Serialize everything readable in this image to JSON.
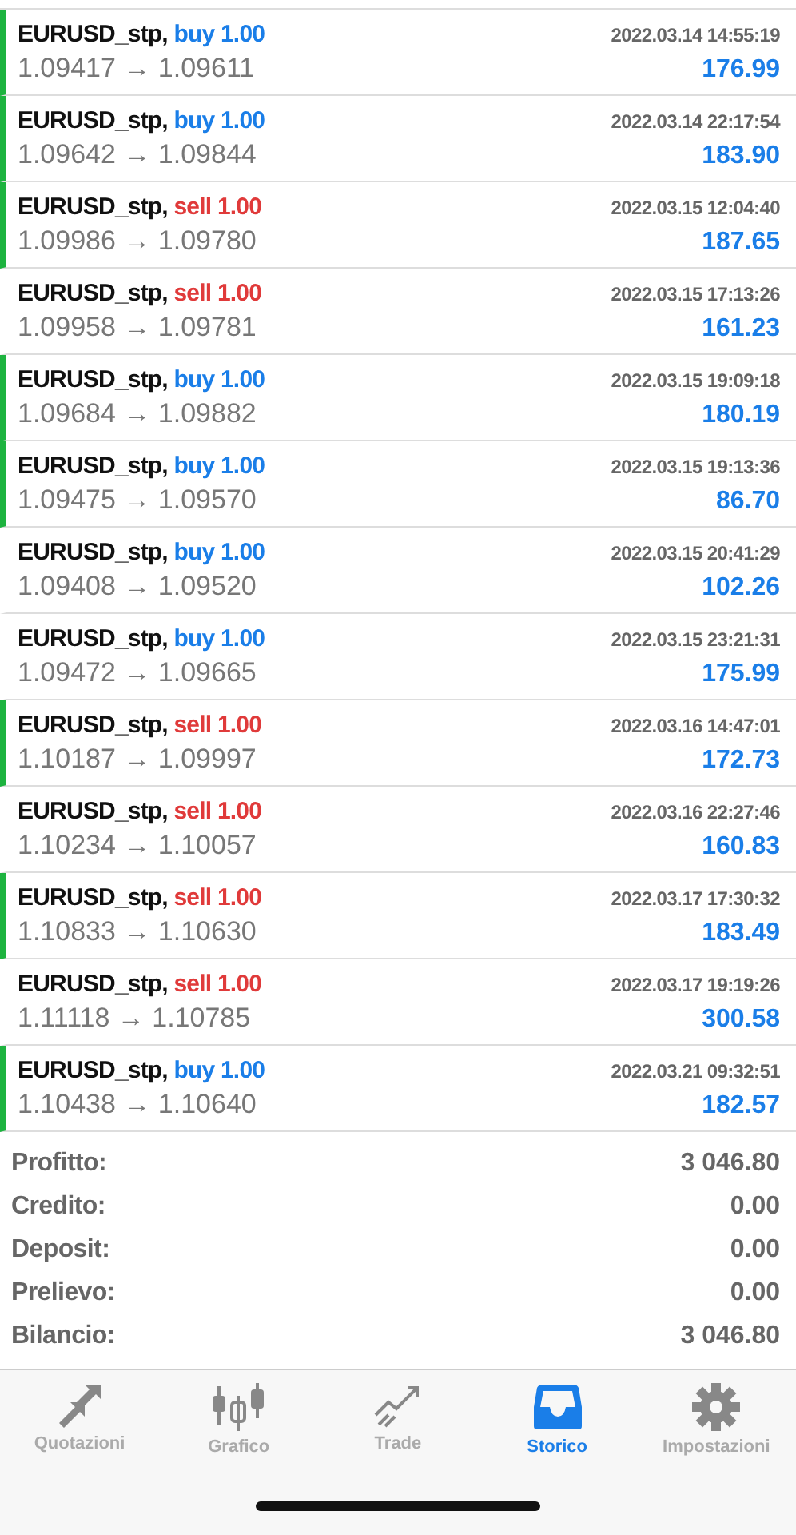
{
  "deals": [
    {
      "symbol": "EURUSD_stp,",
      "side": "buy",
      "volume": "1.00",
      "marked": true,
      "time": "2022.03.14 14:55:19",
      "prices": "1.09417 → 1.09611",
      "profit": "176.99"
    },
    {
      "symbol": "EURUSD_stp,",
      "side": "buy",
      "volume": "1.00",
      "marked": true,
      "time": "2022.03.14 22:17:54",
      "prices": "1.09642 → 1.09844",
      "profit": "183.90"
    },
    {
      "symbol": "EURUSD_stp,",
      "side": "sell",
      "volume": "1.00",
      "marked": true,
      "time": "2022.03.15 12:04:40",
      "prices": "1.09986 → 1.09780",
      "profit": "187.65"
    },
    {
      "symbol": "EURUSD_stp,",
      "side": "sell",
      "volume": "1.00",
      "marked": false,
      "time": "2022.03.15 17:13:26",
      "prices": "1.09958 → 1.09781",
      "profit": "161.23"
    },
    {
      "symbol": "EURUSD_stp,",
      "side": "buy",
      "volume": "1.00",
      "marked": true,
      "time": "2022.03.15 19:09:18",
      "prices": "1.09684 → 1.09882",
      "profit": "180.19"
    },
    {
      "symbol": "EURUSD_stp,",
      "side": "buy",
      "volume": "1.00",
      "marked": true,
      "time": "2022.03.15 19:13:36",
      "prices": "1.09475 → 1.09570",
      "profit": "86.70"
    },
    {
      "symbol": "EURUSD_stp,",
      "side": "buy",
      "volume": "1.00",
      "marked": false,
      "time": "2022.03.15 20:41:29",
      "prices": "1.09408 → 1.09520",
      "profit": "102.26"
    },
    {
      "symbol": "EURUSD_stp,",
      "side": "buy",
      "volume": "1.00",
      "marked": false,
      "time": "2022.03.15 23:21:31",
      "prices": "1.09472 → 1.09665",
      "profit": "175.99"
    },
    {
      "symbol": "EURUSD_stp,",
      "side": "sell",
      "volume": "1.00",
      "marked": true,
      "time": "2022.03.16 14:47:01",
      "prices": "1.10187 → 1.09997",
      "profit": "172.73"
    },
    {
      "symbol": "EURUSD_stp,",
      "side": "sell",
      "volume": "1.00",
      "marked": false,
      "time": "2022.03.16 22:27:46",
      "prices": "1.10234 → 1.10057",
      "profit": "160.83"
    },
    {
      "symbol": "EURUSD_stp,",
      "side": "sell",
      "volume": "1.00",
      "marked": true,
      "time": "2022.03.17 17:30:32",
      "prices": "1.10833 → 1.10630",
      "profit": "183.49"
    },
    {
      "symbol": "EURUSD_stp,",
      "side": "sell",
      "volume": "1.00",
      "marked": false,
      "time": "2022.03.17 19:19:26",
      "prices": "1.11118 → 1.10785",
      "profit": "300.58"
    },
    {
      "symbol": "EURUSD_stp,",
      "side": "buy",
      "volume": "1.00",
      "marked": true,
      "time": "2022.03.21 09:32:51",
      "prices": "1.10438 → 1.10640",
      "profit": "182.57"
    }
  ],
  "summary": [
    {
      "label": "Profitto:",
      "value": "3 046.80"
    },
    {
      "label": "Credito:",
      "value": "0.00"
    },
    {
      "label": "Deposit:",
      "value": "0.00"
    },
    {
      "label": "Prelievo:",
      "value": "0.00"
    },
    {
      "label": "Bilancio:",
      "value": "3 046.80"
    }
  ],
  "tabs": [
    {
      "kind": "quotes",
      "label": "Quotazioni",
      "selected": false
    },
    {
      "kind": "chart",
      "label": "Grafico",
      "selected": false
    },
    {
      "kind": "trade",
      "label": "Trade",
      "selected": false
    },
    {
      "kind": "history",
      "label": "Storico",
      "selected": true
    },
    {
      "kind": "settings",
      "label": "Impostazioni",
      "selected": false
    }
  ]
}
